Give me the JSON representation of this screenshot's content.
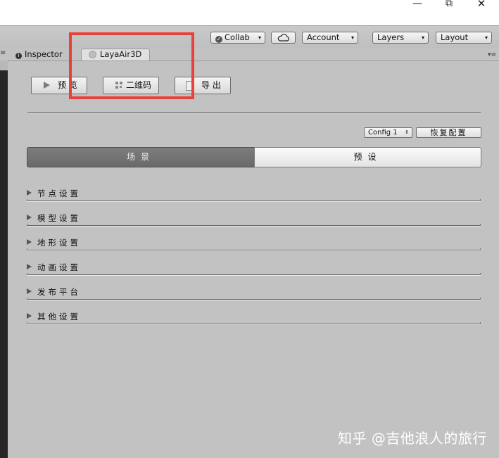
{
  "window_controls": {
    "minimize": "—",
    "maximize": "⧉",
    "close": "✕"
  },
  "toolbar": {
    "collab_label": "Collab",
    "account_label": "Account",
    "layers_label": "Layers",
    "layout_label": "Layout",
    "dropdown_glyph": "▾"
  },
  "tabs": {
    "inspector_label": "Inspector",
    "laya_label": "LayaAir3D",
    "menu_glyph": "▾≡",
    "left_menu_glyph": "≡"
  },
  "actions": {
    "preview_label": "预 览",
    "qrcode_label": "二维码",
    "export_label": "导 出"
  },
  "config": {
    "selected": "Config 1",
    "reset_label": "恢复配置",
    "select_glyph": "⇕"
  },
  "segments": {
    "scene_label": "场景",
    "preset_label": "预设"
  },
  "sections": [
    {
      "label": "节点设置"
    },
    {
      "label": "模型设置"
    },
    {
      "label": "地形设置"
    },
    {
      "label": "动画设置"
    },
    {
      "label": "发布平台"
    },
    {
      "label": "其他设置"
    }
  ],
  "watermark": "知乎 @吉他浪人的旅行",
  "colors": {
    "highlight_box": "#e8403a",
    "selected_segment": "#6e6e6e",
    "panel_bg": "#c2c2c2"
  }
}
